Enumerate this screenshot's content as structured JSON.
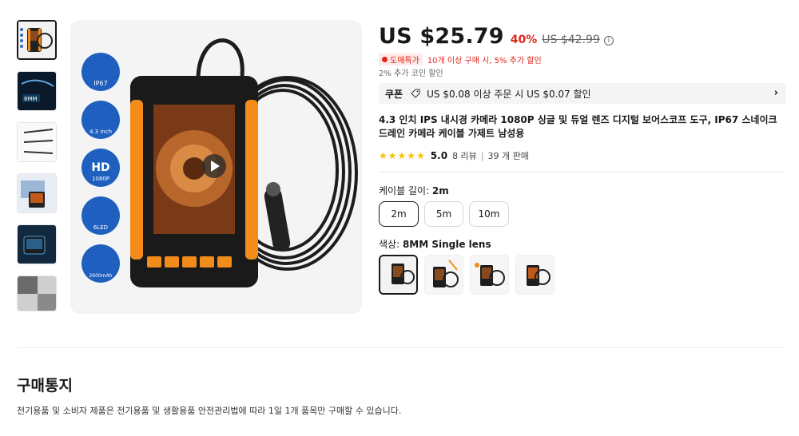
{
  "product": {
    "price": "US $25.79",
    "discount": "40%",
    "original_price": "US $42.99",
    "info_icon_glyph": "i",
    "tag_label": "도매특가",
    "tag_text": "10개 이상 구매 시, 5% 추가 할인",
    "coin_text": "2% 추가 코인 할인",
    "title": "4.3 인치 IPS 내시경 카메라 1080P 싱글 및 듀얼 렌즈 디지털 보어스코프 도구, IP67 스네이크 드레인 카메라 케이블 가제트 남성용",
    "rating": {
      "stars": "★★★★★",
      "score": "5.0",
      "reviews": "8 리뷰",
      "separator": "|",
      "sold": "39 개 판매"
    }
  },
  "coupon": {
    "label": "쿠폰",
    "text": "US $0.08 이상 주문 시 US $0.07 할인",
    "arrow": "›"
  },
  "options": {
    "cable_label": "케이블 길이:",
    "cable_selected": "2m",
    "cable_sizes": [
      "2m",
      "5m",
      "10m"
    ],
    "color_label": "색상:",
    "color_selected": "8MM Single lens"
  },
  "main_image_badges": [
    "IP67",
    "4.3 inch",
    "HD",
    "1080P",
    "6LED",
    "2600mAh"
  ],
  "notice": {
    "title": "구매통지",
    "text": "전기용품 및 소비자 제품은 전기용품 및 생활용품 안전관리법에 따라 1일 1개 품목만 구매할 수 있습니다."
  },
  "colors": {
    "accent_red": "#e1251b",
    "star_yellow": "#fac000",
    "device_orange": "#f28c1b"
  }
}
